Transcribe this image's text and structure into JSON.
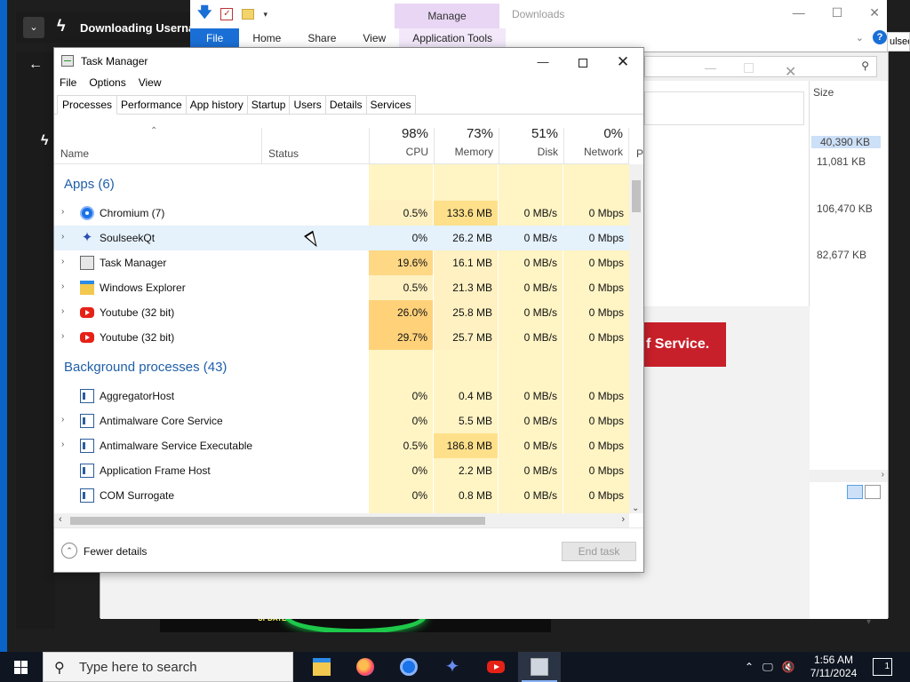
{
  "background_app": {
    "title": "Downloading Usernam",
    "chevron": "⌄",
    "back": "←"
  },
  "explorer": {
    "manage_label": "Manage",
    "window_title": "Downloads",
    "ribbon": [
      "File",
      "Home",
      "Share",
      "View",
      "Application Tools"
    ],
    "addr_fragment": "ulseek",
    "help": "?"
  },
  "downloads_window": {
    "size_header": "Size",
    "sizes": [
      "40,390 KB",
      "11,081 KB",
      "106,470 KB",
      "82,677 KB"
    ],
    "banner_text": "f Service."
  },
  "task_manager": {
    "title": "Task Manager",
    "menu": [
      "File",
      "Options",
      "View"
    ],
    "tabs": [
      "Processes",
      "Performance",
      "App history",
      "Startup",
      "Users",
      "Details",
      "Services"
    ],
    "active_tab": "Processes",
    "columns": {
      "name": "Name",
      "status": "Status",
      "cpu": {
        "pct": "98%",
        "label": "CPU"
      },
      "memory": {
        "pct": "73%",
        "label": "Memory"
      },
      "disk": {
        "pct": "51%",
        "label": "Disk"
      },
      "network": {
        "pct": "0%",
        "label": "Network"
      },
      "power": "P"
    },
    "apps_group": "Apps (6)",
    "apps": [
      {
        "name": "Chromium (7)",
        "icon": "chromium-icon",
        "cpu": "0.5%",
        "memory": "133.6 MB",
        "disk": "0 MB/s",
        "network": "0 Mbps",
        "cpu_heat": "#fff1c2",
        "mem_heat": "#ffe08a"
      },
      {
        "name": "SoulseekQt",
        "icon": "soulseek-icon",
        "cpu": "0%",
        "memory": "26.2 MB",
        "disk": "0 MB/s",
        "network": "0 Mbps",
        "cpu_heat": "#e5f1fb",
        "mem_heat": "#e5f1fb"
      },
      {
        "name": "Task Manager",
        "icon": "task-manager-icon",
        "cpu": "19.6%",
        "memory": "16.1 MB",
        "disk": "0 MB/s",
        "network": "0 Mbps",
        "cpu_heat": "#ffd885",
        "mem_heat": "#fff1c2"
      },
      {
        "name": "Windows Explorer",
        "icon": "windows-explorer-icon",
        "cpu": "0.5%",
        "memory": "21.3 MB",
        "disk": "0 MB/s",
        "network": "0 Mbps",
        "cpu_heat": "#fff1c2",
        "mem_heat": "#fff1c2"
      },
      {
        "name": "Youtube (32 bit)",
        "icon": "youtube-icon",
        "cpu": "26.0%",
        "memory": "25.8 MB",
        "disk": "0 MB/s",
        "network": "0 Mbps",
        "cpu_heat": "#ffd27a",
        "mem_heat": "#fff1c2"
      },
      {
        "name": "Youtube (32 bit)",
        "icon": "youtube-icon",
        "cpu": "29.7%",
        "memory": "25.7 MB",
        "disk": "0 MB/s",
        "network": "0 Mbps",
        "cpu_heat": "#ffd27a",
        "mem_heat": "#fff1c2"
      }
    ],
    "bg_group": "Background processes (43)",
    "background": [
      {
        "name": "AggregatorHost",
        "expand": false,
        "cpu": "0%",
        "memory": "0.4 MB",
        "disk": "0 MB/s",
        "network": "0 Mbps",
        "mem_heat": "#fff4c4"
      },
      {
        "name": "Antimalware Core Service",
        "expand": true,
        "cpu": "0%",
        "memory": "5.5 MB",
        "disk": "0 MB/s",
        "network": "0 Mbps",
        "mem_heat": "#fff4c4"
      },
      {
        "name": "Antimalware Service Executable",
        "expand": true,
        "cpu": "0.5%",
        "memory": "186.8 MB",
        "disk": "0 MB/s",
        "network": "0 Mbps",
        "mem_heat": "#ffe08a"
      },
      {
        "name": "Application Frame Host",
        "expand": false,
        "cpu": "0%",
        "memory": "2.2 MB",
        "disk": "0 MB/s",
        "network": "0 Mbps",
        "mem_heat": "#fff4c4"
      },
      {
        "name": "COM Surrogate",
        "expand": false,
        "cpu": "0%",
        "memory": "0.8 MB",
        "disk": "0 MB/s",
        "network": "0 Mbps",
        "mem_heat": "#fff4c4"
      }
    ],
    "fewer_details": "Fewer details",
    "end_task": "End task"
  },
  "taskbar": {
    "search_placeholder": "Type here to search",
    "apps": [
      "file-explorer-icon",
      "firefox-icon",
      "chromium-icon",
      "soulseek-icon",
      "youtube-icon",
      "task-manager-icon"
    ],
    "time": "1:56 AM",
    "date": "7/11/2024",
    "notifications": "1"
  },
  "colors": {
    "accent": "#1a6fd6",
    "group_text": "#1f5fa8",
    "heat_light": "#fff4c4",
    "taskbar": "#0f1622"
  }
}
